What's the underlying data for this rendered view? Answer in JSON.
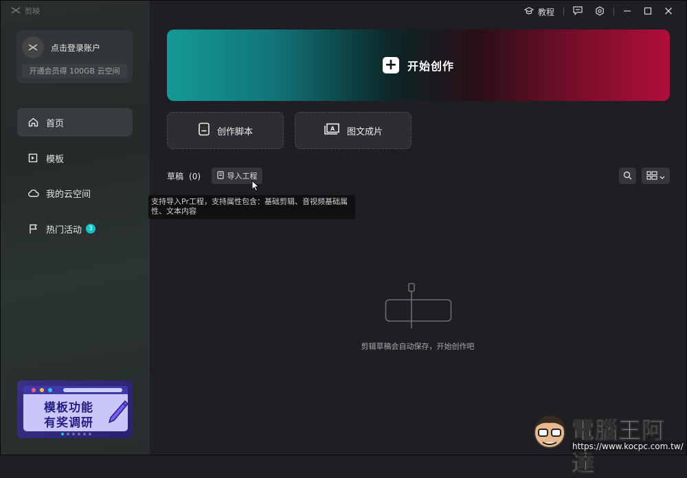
{
  "app": {
    "name": "剪映"
  },
  "titlebar": {
    "tutorial": "教程"
  },
  "user": {
    "login": "点击登录账户",
    "storage_promo": "开通会员得 100GB 云空间"
  },
  "nav": {
    "items": [
      {
        "label": "首页",
        "icon": "home-icon",
        "active": true
      },
      {
        "label": "模板",
        "icon": "template-icon"
      },
      {
        "label": "我的云空间",
        "icon": "cloud-icon"
      },
      {
        "label": "热门活动",
        "icon": "flag-icon",
        "badge": "3"
      }
    ]
  },
  "banner": {
    "line1": "模板功能",
    "line2": "有奖调研"
  },
  "hero": {
    "label": "开始创作"
  },
  "actions": {
    "script": "创作脚本",
    "image_text": "图文成片"
  },
  "drafts": {
    "label": "草稿",
    "count": "(0)",
    "import_label": "导入工程"
  },
  "tooltip": {
    "text": "支持导入Pr工程，支持属性包含：基础剪辑、音视频基础属性、文本内容"
  },
  "empty": {
    "text": "剪辑草稿会自动保存，开始创作吧"
  },
  "watermark": {
    "title": "電腦王阿達",
    "url": "https://www.kocpc.com.tw/"
  },
  "colors": {
    "accent": "#15c4c8",
    "hero_left": "#159a97",
    "hero_right": "#b00d3b",
    "background": "#1f1f23"
  }
}
